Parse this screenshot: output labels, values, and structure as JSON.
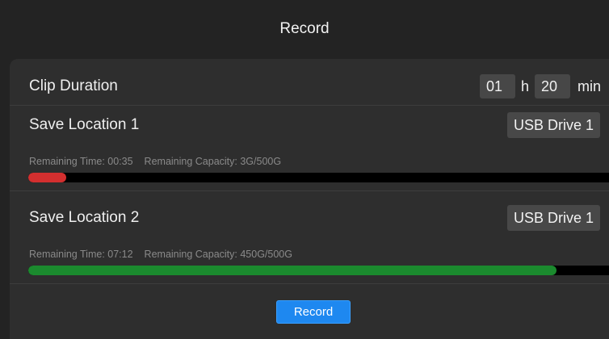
{
  "dialog": {
    "title": "Record"
  },
  "clip_duration": {
    "label": "Clip Duration",
    "hours": "01",
    "hours_unit": "h",
    "minutes": "20",
    "minutes_unit": "min"
  },
  "locations": [
    {
      "label": "Save Location 1",
      "drive": "USB Drive 1",
      "remaining_time": "Remaining Time: 00:35",
      "remaining_capacity": "Remaining Capacity: 3G/500G",
      "usage_fraction": 0.066,
      "bar_color": "#d32f2f"
    },
    {
      "label": "Save Location 2",
      "drive": "USB Drive 1",
      "remaining_time": "Remaining Time: 07:12",
      "remaining_capacity": "Remaining Capacity: 450G/500G",
      "usage_fraction": 0.91,
      "bar_color": "#1b8a2e"
    }
  ],
  "actions": {
    "record_label": "Record"
  },
  "colors": {
    "accent": "#1e88f0",
    "panel_bg": "#2e2e2e",
    "window_bg": "#232323"
  }
}
